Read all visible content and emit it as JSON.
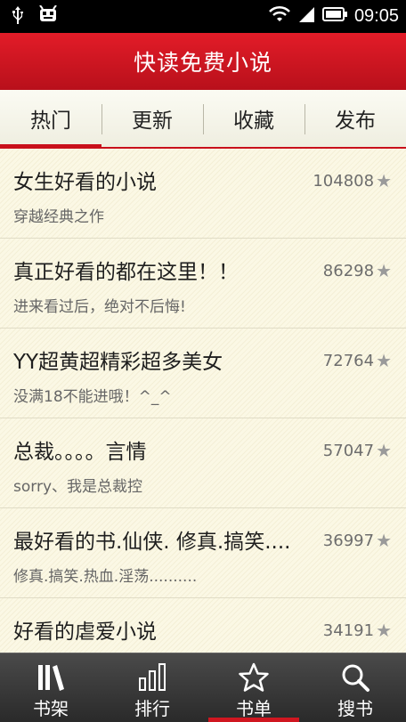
{
  "status_bar": {
    "time": "09:05"
  },
  "app": {
    "title": "快读免费小说"
  },
  "tabs": [
    {
      "label": "热门",
      "active": true
    },
    {
      "label": "更新",
      "active": false
    },
    {
      "label": "收藏",
      "active": false
    },
    {
      "label": "发布",
      "active": false
    }
  ],
  "books": [
    {
      "name": "女生好看的小说",
      "desc": "穿越经典之作",
      "count": "104808"
    },
    {
      "name": "真正好看的都在这里！！",
      "desc": "进来看过后，绝对不后悔!",
      "count": "86298"
    },
    {
      "name": "YY超黄超精彩超多美女",
      "desc": "没满18不能进哦！^_^",
      "count": "72764"
    },
    {
      "name": "总裁。。。。言情",
      "desc": "sorry、我是总裁控",
      "count": "57047"
    },
    {
      "name": "最好看的书.仙侠. 修真.搞笑....",
      "desc": "修真.搞笑.热血.淫荡..........",
      "count": "36997"
    },
    {
      "name": "好看的虐爱小说",
      "desc": "",
      "count": "34191"
    }
  ],
  "bottom_nav": [
    {
      "label": "书架",
      "icon": "bookshelf-icon",
      "active": false
    },
    {
      "label": "排行",
      "icon": "ranking-bars-icon",
      "active": false
    },
    {
      "label": "书单",
      "icon": "star-icon",
      "active": true
    },
    {
      "label": "搜书",
      "icon": "search-icon",
      "active": false
    }
  ],
  "colors": {
    "accent": "#c9101b",
    "title_bar": "#d0141f",
    "background": "#fbf8e7"
  }
}
